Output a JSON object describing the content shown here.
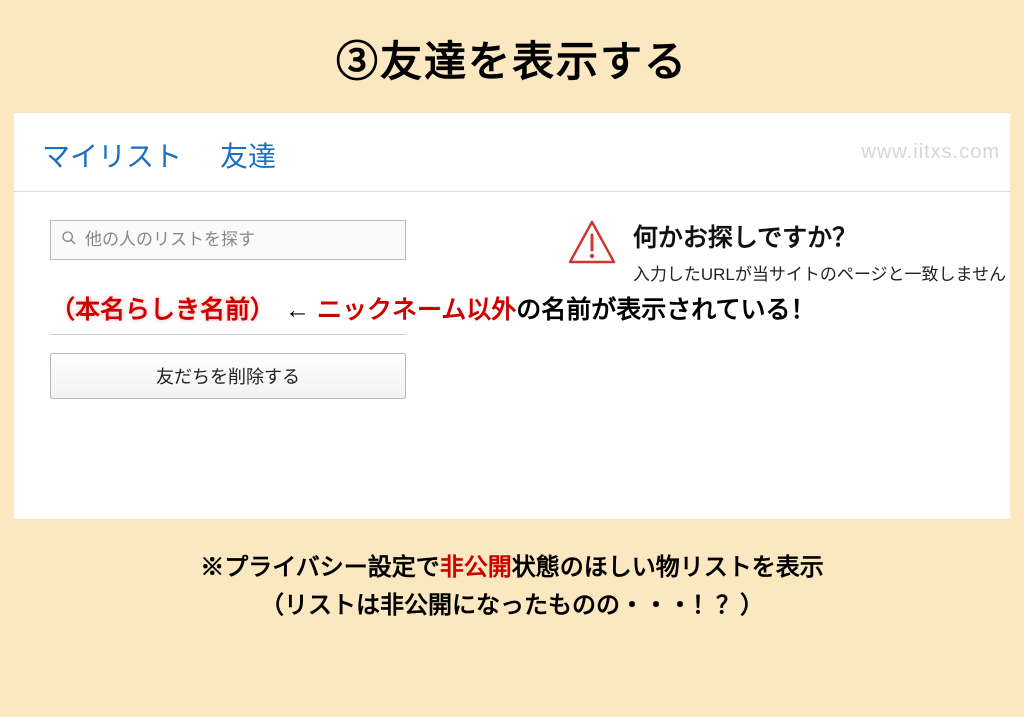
{
  "page_title": "③友達を表示する",
  "tabs": {
    "mylist": "マイリスト",
    "friends": "友達"
  },
  "watermark": "www.iitxs.com",
  "search": {
    "placeholder": "他の人のリストを探す"
  },
  "annotation": {
    "real_name_label": "（本名らしき名前）",
    "arrow": "←",
    "nickname_text": "ニックネーム以外",
    "suffix_text": "の名前が表示されている！"
  },
  "delete_button": "友だちを削除する",
  "error": {
    "heading": "何かお探しですか？",
    "sub": "入力したURLが当サイトのページと一致しません"
  },
  "footer": {
    "prefix": "※プライバシー設定で",
    "red": "非公開",
    "suffix": "状態のほしい物リストを表示",
    "line2": "（リストは非公開になったものの・・・！？）"
  }
}
